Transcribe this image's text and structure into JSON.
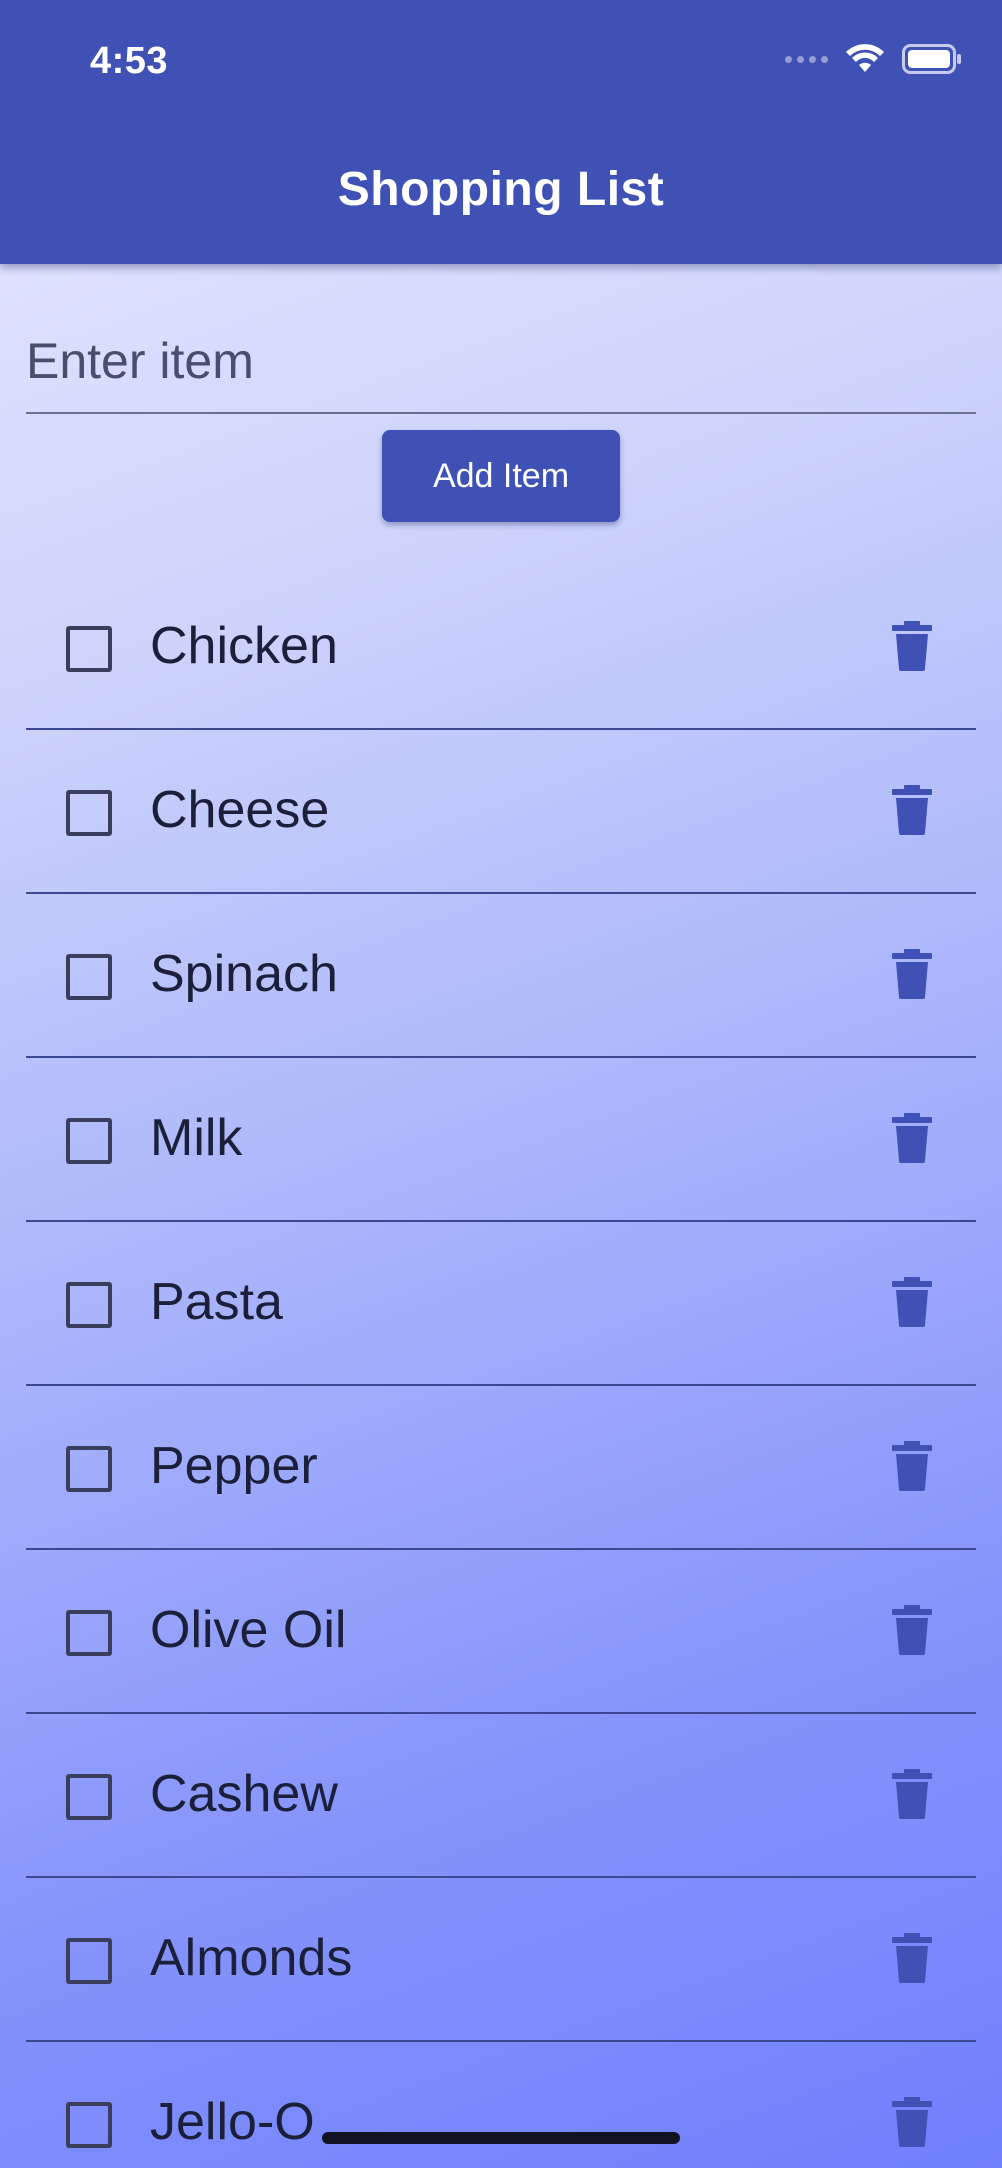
{
  "status_bar": {
    "time": "4:53",
    "icons": [
      "cellular-signal-icon",
      "wifi-icon",
      "battery-icon"
    ]
  },
  "app_bar": {
    "title": "Shopping List"
  },
  "input": {
    "placeholder": "Enter item",
    "value": ""
  },
  "add_button": {
    "label": "Add Item"
  },
  "list": {
    "items": [
      {
        "label": "Chicken",
        "checked": false
      },
      {
        "label": "Cheese",
        "checked": false
      },
      {
        "label": "Spinach",
        "checked": false
      },
      {
        "label": "Milk",
        "checked": false
      },
      {
        "label": "Pasta",
        "checked": false
      },
      {
        "label": "Pepper",
        "checked": false
      },
      {
        "label": "Olive Oil",
        "checked": false
      },
      {
        "label": "Cashew",
        "checked": false
      },
      {
        "label": "Almonds",
        "checked": false
      },
      {
        "label": "Jello-O",
        "checked": false
      }
    ],
    "delete_icon": "trash-icon"
  },
  "colors": {
    "primary": "#3f51b5",
    "text": "#1c1f3a",
    "gradient_start": "#e8ebff",
    "gradient_end": "#6f80fc"
  }
}
